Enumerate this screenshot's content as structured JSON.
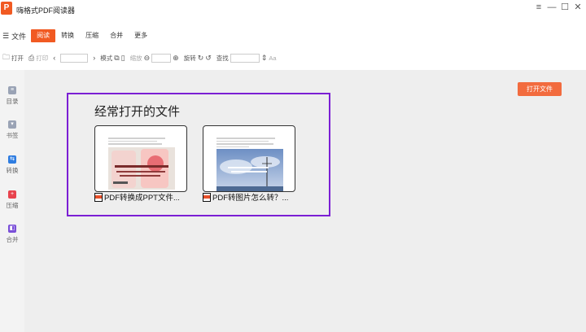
{
  "app": {
    "logo_glyph": "P",
    "title": "嗨格式PDF阅读器"
  },
  "window_controls": {
    "menu": "≡",
    "minimize": "—",
    "maximize": "☐",
    "close": "✕"
  },
  "menubar": {
    "toggle_label": "文件",
    "items": [
      {
        "label": "阅读",
        "active": true
      },
      {
        "label": "转换",
        "active": false
      },
      {
        "label": "压缩",
        "active": false
      },
      {
        "label": "合并",
        "active": false
      },
      {
        "label": "更多",
        "active": false
      }
    ]
  },
  "toolbar": {
    "open_label": "打开",
    "print_label": "打印",
    "prev": "‹",
    "next": "›",
    "mode_label": "模式",
    "zoom_label": "缩放",
    "rotate_label": "旋转",
    "find_label": "查找",
    "case_label": "Aa"
  },
  "sidebar": {
    "items": [
      {
        "label": "目录",
        "icon": "toc-icon",
        "color": "#9aa3b5"
      },
      {
        "label": "书签",
        "icon": "bookmark-icon",
        "color": "#9aa3b5"
      },
      {
        "label": "转换",
        "icon": "convert-icon",
        "color": "#2f7de1"
      },
      {
        "label": "压缩",
        "icon": "compress-icon",
        "color": "#e8434d"
      },
      {
        "label": "合并",
        "icon": "merge-icon",
        "color": "#7a4fd8"
      }
    ]
  },
  "main": {
    "open_file_button": "打开文件",
    "recent_title": "经常打开的文件",
    "files": [
      {
        "name": "PDF转换成PPT文件..."
      },
      {
        "name": "PDF转图片怎么转？..."
      }
    ]
  },
  "colors": {
    "accent": "#f15a22",
    "highlight": "#7b1fd4"
  }
}
